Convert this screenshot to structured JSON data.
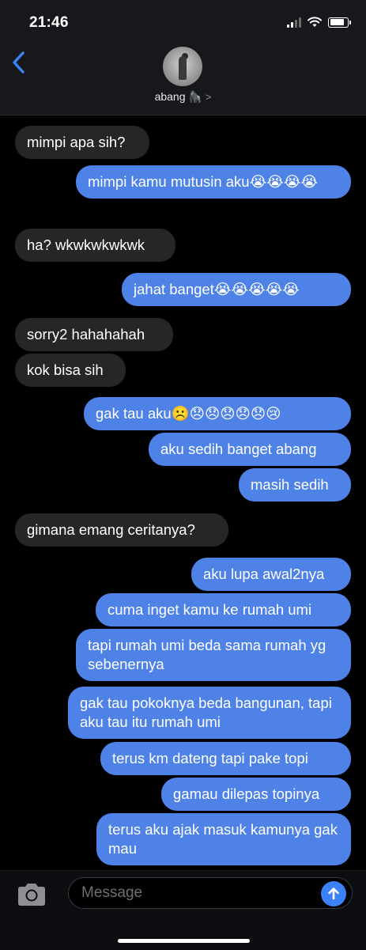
{
  "status_bar": {
    "time": "21:46"
  },
  "header": {
    "contact_name": "abang 🦍"
  },
  "messages": [
    {
      "dir": "in",
      "text": "mimpi apa sih?"
    },
    {
      "dir": "out",
      "text": "mimpi kamu mutusin aku😭😭😭😭"
    },
    {
      "dir": "in",
      "text": "ha? wkwkwkwkwk"
    },
    {
      "dir": "out",
      "text": "jahat banget😭😭😭😭😭"
    },
    {
      "dir": "in",
      "text": "sorry2 hahahahah"
    },
    {
      "dir": "in",
      "text": "kok bisa sih"
    },
    {
      "dir": "out",
      "text": "gak tau aku☹️😞😞😞😞😞😢"
    },
    {
      "dir": "out",
      "text": "aku sedih banget abang"
    },
    {
      "dir": "out",
      "text": "masih sedih"
    },
    {
      "dir": "in",
      "text": "gimana emang ceritanya?"
    },
    {
      "dir": "out",
      "text": "aku lupa awal2nya"
    },
    {
      "dir": "out",
      "text": "cuma inget kamu ke rumah umi"
    },
    {
      "dir": "out",
      "text": "tapi rumah umi beda sama rumah yg sebenernya"
    },
    {
      "dir": "out",
      "text": "gak tau pokoknya beda bangunan, tapi aku tau itu rumah umi"
    },
    {
      "dir": "out",
      "text": "terus km dateng tapi pake topi"
    },
    {
      "dir": "out",
      "text": "gamau dilepas topinya"
    },
    {
      "dir": "out",
      "text": "terus aku ajak masuk kamunya gak mau"
    }
  ],
  "composer": {
    "placeholder": "Message"
  },
  "colors": {
    "incoming": "#262629",
    "outgoing": "#4e82e6",
    "accent": "#3b82f6"
  }
}
